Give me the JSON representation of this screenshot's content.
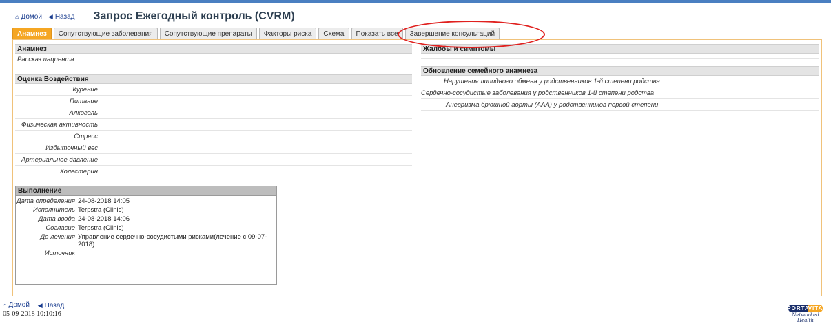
{
  "header": {
    "home_label": "Домой",
    "back_label": "Назад",
    "title": "Запрос Ежегодный контроль (CVRM)"
  },
  "tabs": [
    {
      "label": "Анамнез",
      "active": true
    },
    {
      "label": "Сопутствующие заболевания"
    },
    {
      "label": "Сопутствующие препараты"
    },
    {
      "label": "Факторы риска"
    },
    {
      "label": "Схема"
    },
    {
      "label": "Показать все"
    },
    {
      "label": "Завершение консультаций"
    }
  ],
  "left": {
    "anamnesis_title": "Анамнез",
    "patient_story": "Рассказ пациента",
    "impact_title": "Оценка Воздействия",
    "impact_items": [
      "Курение",
      "Питание",
      "Алкоголь",
      "Физическая активность",
      "Стресс",
      "Избыточный вес",
      "Артериальное давление",
      "Холестерин"
    ]
  },
  "execution": {
    "title": "Выполнение",
    "rows": [
      {
        "key": "Дата определения",
        "value": "24-08-2018 14:05"
      },
      {
        "key": "Исполнитель",
        "value": "Terpstra (Clinic)"
      },
      {
        "key": "Дата ввода",
        "value": "24-08-2018 14:06"
      },
      {
        "key": "Согласие",
        "value": "Terpstra (Clinic)"
      },
      {
        "key": "До лечения",
        "value": "Управление сердечно-сосудистыми рисками(лечение с 09-07-2018)"
      },
      {
        "key": "Источник",
        "value": ""
      }
    ]
  },
  "right": {
    "complaints_title": "Жалобы и симптомы",
    "family_title": "Обновление семейного анамнеза",
    "family_items": [
      "Нарушения липидного обмена у родственников 1-й степени родства",
      "Сердечно-сосудистые заболевания у родственников 1-й степени родства",
      "Аневризма брюшной аорты (ААА) у родственников первой степени"
    ]
  },
  "footer": {
    "home_label": "Домой",
    "back_label": "Назад",
    "timestamp": "05-09-2018 10:10:16",
    "logo_left": "PORTA",
    "logo_right": "VITA",
    "logo_tagline": "Networked Health"
  },
  "colors": {
    "accent": "#f5a623",
    "annotation": "#e0201e",
    "link": "#1a3d8f"
  }
}
